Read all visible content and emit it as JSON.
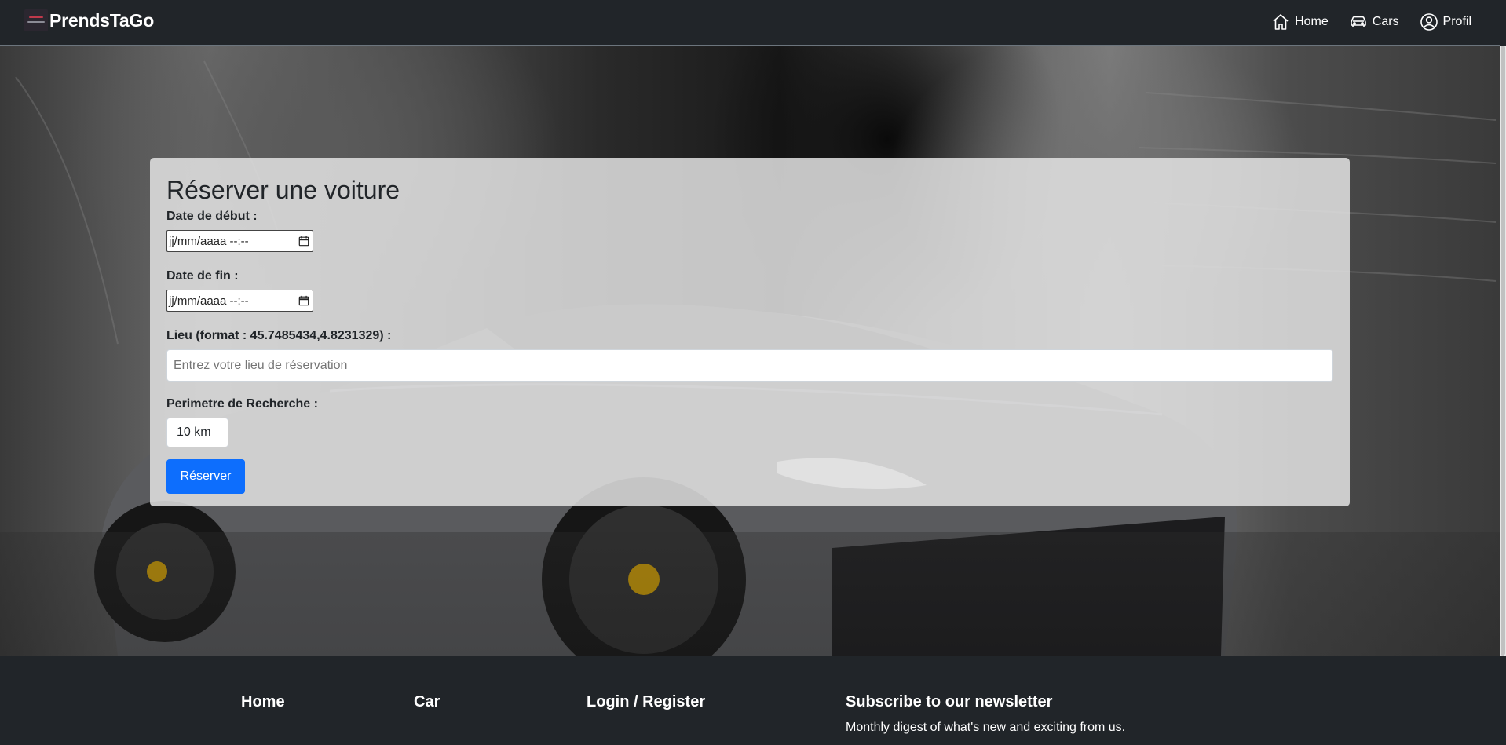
{
  "navbar": {
    "brand": "PrendsTaGo",
    "links": [
      {
        "label": "Home",
        "icon": "house-icon"
      },
      {
        "label": "Cars",
        "icon": "car-icon"
      },
      {
        "label": "Profil",
        "icon": "user-circle-icon"
      }
    ]
  },
  "form": {
    "title": "Réserver une voiture",
    "start_date_label": "Date de début :",
    "start_date_value": "jj/mm/aaaa --:--",
    "end_date_label": "Date de fin :",
    "end_date_value": "jj/mm/aaaa --:--",
    "location_label": "Lieu (format : 45.7485434,4.8231329) :",
    "location_placeholder": "Entrez votre lieu de réservation",
    "radius_label": "Perimetre de Recherche :",
    "radius_value": "10 km",
    "submit_label": "Réserver"
  },
  "footer": {
    "columns": [
      {
        "heading": "Home"
      },
      {
        "heading": "Car"
      },
      {
        "heading": "Login / Register"
      }
    ],
    "newsletter": {
      "heading": "Subscribe to our newsletter",
      "text": "Monthly digest of what's new and exciting from us."
    }
  },
  "colors": {
    "navbar_bg": "#212529",
    "primary": "#0d6efd",
    "card_bg": "rgba(226,226,226,0.86)"
  }
}
